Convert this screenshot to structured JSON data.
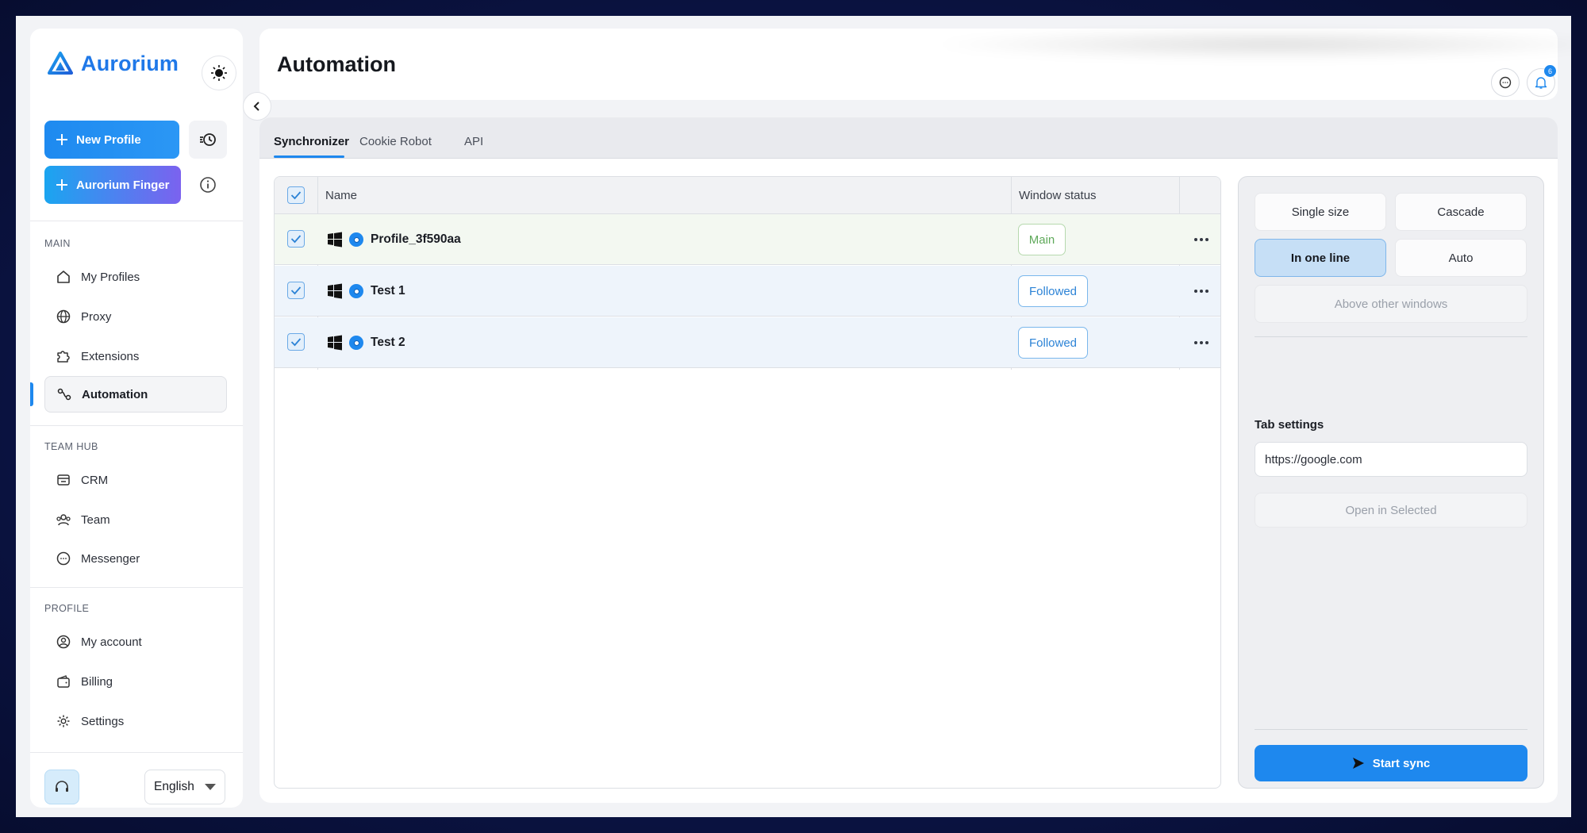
{
  "app": {
    "name": "Aurorium",
    "colors": {
      "accent": "#1e88ee",
      "finger_gradient_start": "#1aa5f0",
      "finger_gradient_end": "#7b62ef"
    }
  },
  "sidebar": {
    "new_profile_label": "New Profile",
    "finger_label": "Aurorium Finger",
    "sections": {
      "main": "MAIN",
      "team": "TEAM HUB",
      "profile": "PROFILE"
    },
    "items": [
      {
        "label": "My Profiles",
        "icon": "home-icon"
      },
      {
        "label": "Proxy",
        "icon": "globe-icon"
      },
      {
        "label": "Extensions",
        "icon": "puzzle-icon"
      },
      {
        "label": "Automation",
        "icon": "automation-icon",
        "active": true
      },
      {
        "label": "CRM",
        "icon": "crm-icon"
      },
      {
        "label": "Team",
        "icon": "team-icon"
      },
      {
        "label": "Messenger",
        "icon": "chat-icon"
      },
      {
        "label": "My account",
        "icon": "user-circle-icon"
      },
      {
        "label": "Billing",
        "icon": "wallet-icon"
      },
      {
        "label": "Settings",
        "icon": "gear-icon"
      }
    ],
    "language": "English"
  },
  "header": {
    "title": "Automation",
    "notification_count": "6"
  },
  "tabs": [
    {
      "label": "Synchronizer",
      "active": true
    },
    {
      "label": "Cookie Robot"
    },
    {
      "label": "API"
    }
  ],
  "table": {
    "columns": [
      "Name",
      "Window status"
    ],
    "rows": [
      {
        "name": "Profile_3f590aa",
        "status": "Main",
        "checked": true
      },
      {
        "name": "Test 1",
        "status": "Followed",
        "checked": true
      },
      {
        "name": "Test 2",
        "status": "Followed",
        "checked": true
      }
    ]
  },
  "panel": {
    "single_size": "Single size",
    "cascade": "Cascade",
    "in_one_line": "In one line",
    "auto": "Auto",
    "above_other_windows": "Above other windows",
    "tab_settings_label": "Tab settings",
    "url_value": "https://google.com",
    "open_in_selected": "Open in Selected",
    "start_sync": "Start sync"
  }
}
